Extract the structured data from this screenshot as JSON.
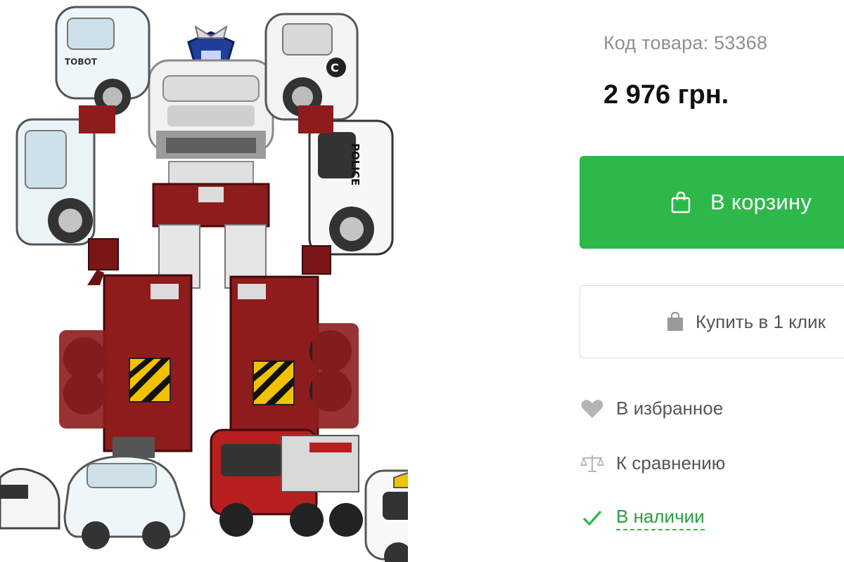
{
  "product": {
    "sku_text": "Код товара: 53368",
    "price_text": "2 976 грн."
  },
  "actions": {
    "add_to_cart_label": "В корзину",
    "buy_one_click_label": "Купить в 1 клик",
    "favorite_label": "В избранное",
    "compare_label": "К сравнению",
    "stock_status_label": "В наличии"
  },
  "colors": {
    "accent_green": "#2fb84a",
    "stock_green": "#2a9c41",
    "muted_text": "#8f8f8f",
    "robot_red": "#8e1c1c"
  },
  "image_text": {
    "car_label_left": "TOBOT",
    "police_label": "POLICE",
    "shoulder_badge": "C"
  },
  "icons": {
    "cart": "shopping-bag-icon",
    "one_click": "bag-filled-icon",
    "favorite": "heart-icon",
    "compare": "scales-icon",
    "stock": "checkmark-icon"
  }
}
